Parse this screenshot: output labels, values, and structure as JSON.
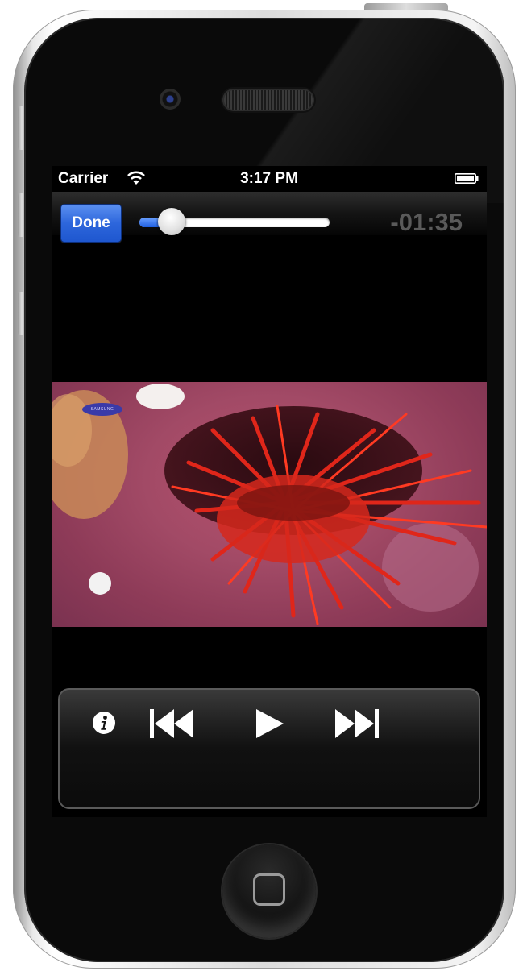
{
  "device": {
    "model": "iPhone",
    "body_color": "#0a0a0a"
  },
  "status_bar": {
    "carrier": "Carrier",
    "time": "3:17 PM",
    "wifi_icon": "wifi-icon",
    "battery_icon": "battery-icon"
  },
  "player": {
    "done_label": "Done",
    "time_remaining": "-01:35",
    "progress_fraction": 0.1,
    "accent_color": "#2d66dc"
  },
  "video": {
    "description_icon": "video-frame-sea-anemone",
    "logo_text": "SAMSUNG"
  },
  "controls": {
    "info_icon": "info-icon",
    "previous_icon": "skip-back-icon",
    "play_icon": "play-icon",
    "next_icon": "skip-forward-icon"
  },
  "home_button_icon": "home-button-icon"
}
